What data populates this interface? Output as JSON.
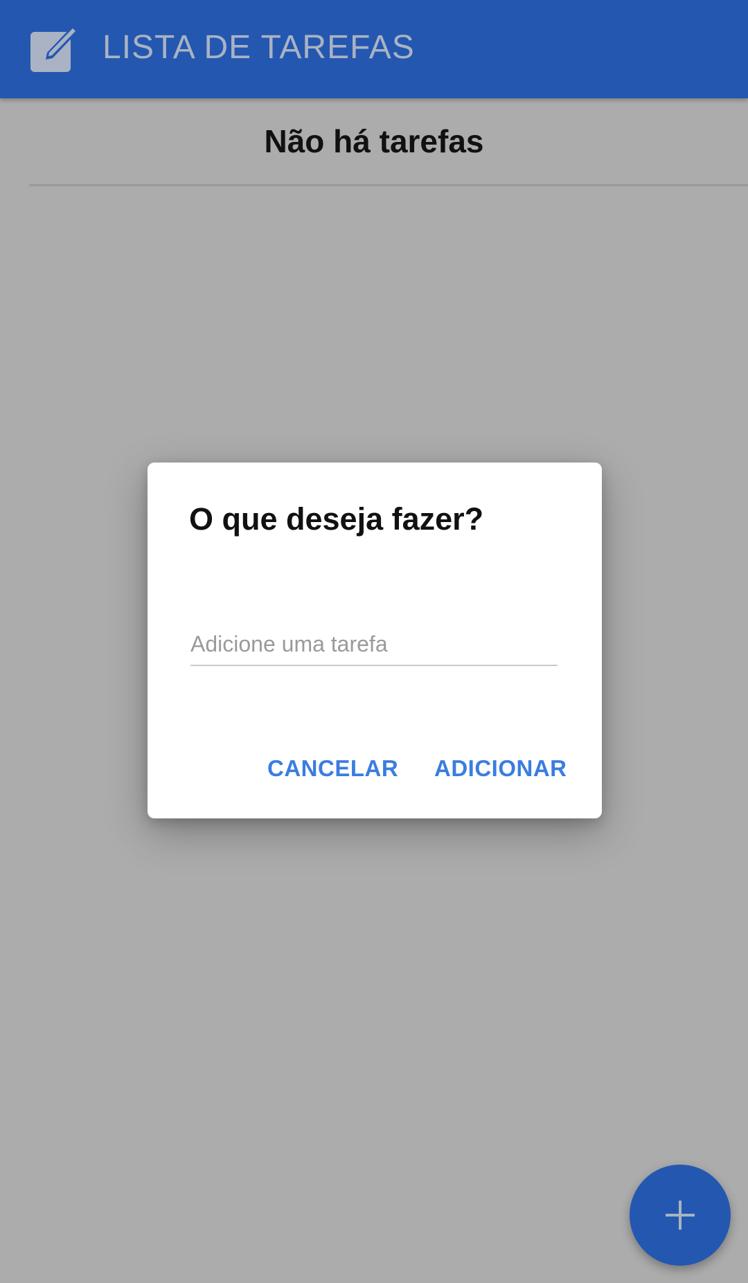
{
  "app_bar": {
    "title": "LISTA DE TAREFAS",
    "icon": "edit-note-icon",
    "background_color": "#2457b0"
  },
  "main": {
    "empty_message": "Não há tarefas"
  },
  "dialog": {
    "title": "O que deseja fazer?",
    "input": {
      "placeholder": "Adicione uma tarefa",
      "value": ""
    },
    "cancel_label": "CANCELAR",
    "add_label": "ADICIONAR",
    "button_color": "#3a7de0"
  },
  "fab": {
    "icon": "plus-icon",
    "background_color": "#2457b0"
  }
}
